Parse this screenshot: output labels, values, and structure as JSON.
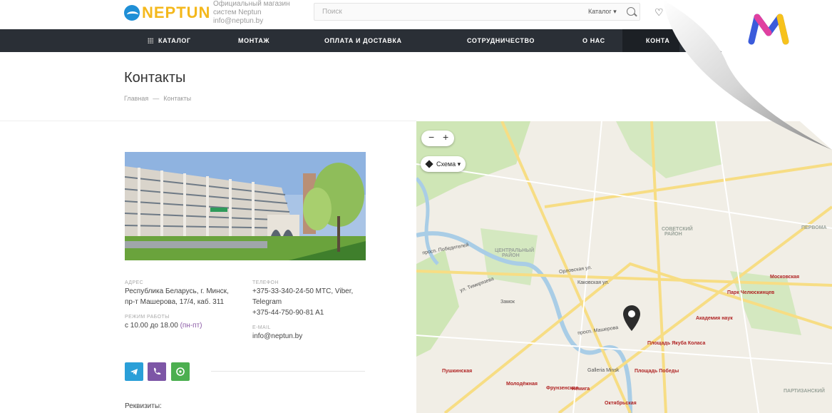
{
  "header": {
    "logo_text": "NEPTUN",
    "shop_line1": "Официальный магазин",
    "shop_line2": "систем Neptun",
    "shop_email": "info@neptun.by",
    "search_placeholder": "Поиск",
    "search_category": "Каталог",
    "nav": [
      "КАТАЛОГ",
      "МОНТАЖ",
      "ОПЛАТА И ДОСТАВКА",
      "СОТРУДНИЧЕСТВО",
      "О НАС",
      "КОНТА"
    ]
  },
  "page": {
    "title": "Контакты",
    "breadcrumb": [
      "Главная",
      "—",
      "Контакты"
    ]
  },
  "contacts": {
    "address_label": "АДРЕС",
    "address_line1": "Республика Беларусь, г. Минск,",
    "address_line2": "пр-т Машерова, 17/4, каб. 311",
    "hours_label": "РЕЖИМ РАБОТЫ",
    "hours_value": "с 10.00 до 18.00",
    "hours_days": "(пн-пт)",
    "phone_label": "ТЕЛЕФОН",
    "phone1": "+375-33-340-24-50 МТС, Viber,",
    "phone1b": "Telegram",
    "phone2": "+375-44-750-90-81 A1",
    "email_label": "E-MAIL",
    "email": "info@neptun.by",
    "requisites": "Реквизиты:"
  },
  "social": [
    {
      "name": "telegram",
      "color": "#2a9fd8"
    },
    {
      "name": "viber",
      "color": "#7d56a6"
    },
    {
      "name": "whatsapp",
      "color": "#4caf50"
    }
  ],
  "map": {
    "zoom_minus": "−",
    "zoom_plus": "+",
    "scheme": "Схема",
    "labels": {
      "sovetsky": "СОВЕТСКИЙ",
      "rayon1": "РАЙОН",
      "central": "ЦЕНТРАЛЬНЫЙ",
      "rayon2": "РАЙОН",
      "pervoma": "ПЕРВОМА",
      "partizan": "ПАРТИЗАНСКИЙ",
      "zamok": "Замок",
      "galleria": "Galleria Minsk",
      "m_moskovskaya": "Московская",
      "m_chel": "Парк Челюскинцев",
      "m_akad": "Академия наук",
      "m_kolasa": "Площадь Якуба Коласа",
      "m_pobedy": "Площадь Победы",
      "m_nemiga": "Немига",
      "m_frunz": "Фрунзенская",
      "m_molod": "Молодёжная",
      "m_pushk": "Пушкинская",
      "m_okt": "Октябрьская",
      "st_masherova": "просп. Машерова",
      "st_orlov": "Орловская ул.",
      "st_pobed": "просп. Победителей",
      "st_tim": "ул. Тимирязева",
      "st_kak": "Каковская ул."
    }
  },
  "colors": {
    "accent": "#f4b81c",
    "nav_bg": "#2a2f36",
    "brand_blue": "#1f8fd6"
  }
}
